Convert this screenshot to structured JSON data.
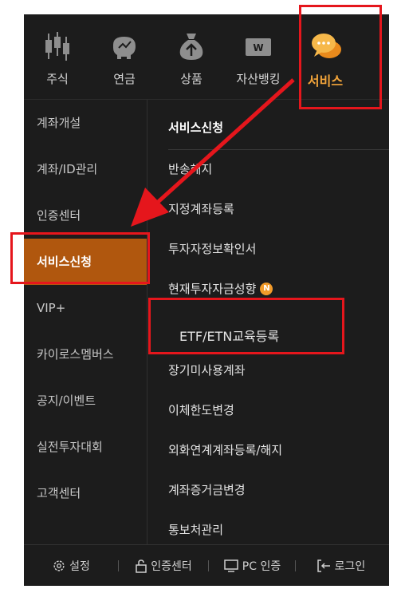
{
  "nav_tabs": [
    {
      "label": "주식",
      "icon": "candlestick-chart-icon"
    },
    {
      "label": "연금",
      "icon": "piggy-bank-icon"
    },
    {
      "label": "상품",
      "icon": "money-bag-icon"
    },
    {
      "label": "자산뱅킹",
      "icon": "bank-card-icon"
    },
    {
      "label": "서비스",
      "icon": "chat-bubbles-icon",
      "active": true
    }
  ],
  "sidebar": {
    "items": [
      {
        "label": "계좌개설"
      },
      {
        "label": "계좌/ID관리"
      },
      {
        "label": "인증센터"
      },
      {
        "label": "서비스신청",
        "active": true
      },
      {
        "label": "VIP+"
      },
      {
        "label": "카이로스멤버스"
      },
      {
        "label": "공지/이벤트"
      },
      {
        "label": "실전투자대회"
      },
      {
        "label": "고객센터"
      }
    ]
  },
  "content": {
    "section_title": "서비스신청",
    "items": [
      {
        "label": "반송해지"
      },
      {
        "label": "지정계좌등록"
      },
      {
        "label": "투자자정보확인서"
      },
      {
        "label": "현재투자자금성향",
        "badge": "N"
      },
      {
        "label": "ETF/ETN교육등록"
      },
      {
        "label": "장기미사용계좌"
      },
      {
        "label": "이체한도변경"
      },
      {
        "label": "외화연계계좌등록/해지"
      },
      {
        "label": "계좌증거금변경"
      },
      {
        "label": "통보처관리"
      }
    ]
  },
  "bottom_bar": {
    "settings": "설정",
    "cert_center": "인증센터",
    "pc_cert": "PC 인증",
    "login": "로그인"
  },
  "colors": {
    "background": "#1c1c1c",
    "accent_orange": "#f2a43a",
    "active_sidebar": "#b0570e",
    "highlight_red": "#e5161c"
  }
}
